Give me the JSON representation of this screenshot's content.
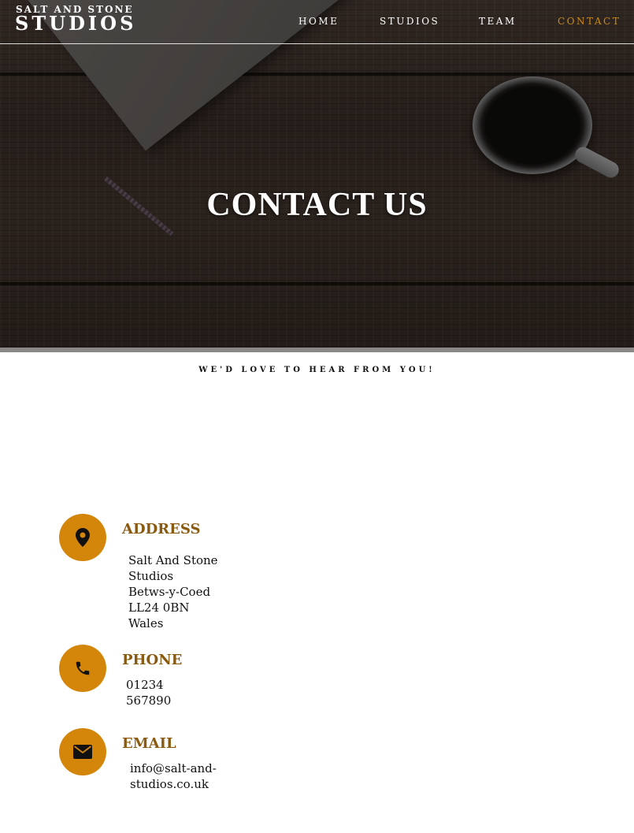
{
  "brand": {
    "top": "SALT AND STONE",
    "main": "STUDIOS"
  },
  "nav": {
    "items": [
      {
        "label": "HOME"
      },
      {
        "label": "STUDIOS"
      },
      {
        "label": "TEAM"
      },
      {
        "label": "CONTACT"
      }
    ],
    "active": "CONTACT"
  },
  "hero": {
    "title": "CONTACT US"
  },
  "tagline": "WE'D LOVE TO HEAR FROM YOU!",
  "contact": {
    "address": {
      "heading": "ADDRESS",
      "icon": "map-marker-icon",
      "lines": [
        "Salt And Stone",
        "Studios",
        "Betws-y-Coed",
        "LL24 0BN",
        "Wales"
      ]
    },
    "phone": {
      "heading": "PHONE",
      "icon": "phone-icon",
      "lines": [
        "01234",
        "567890"
      ]
    },
    "email": {
      "heading": "EMAIL",
      "icon": "envelope-icon",
      "lines": [
        "info@salt-and-",
        "studios.co.uk"
      ]
    }
  },
  "colors": {
    "accent": "#d4860b",
    "heading": "#8a5a10",
    "nav_active": "#d08a10"
  }
}
